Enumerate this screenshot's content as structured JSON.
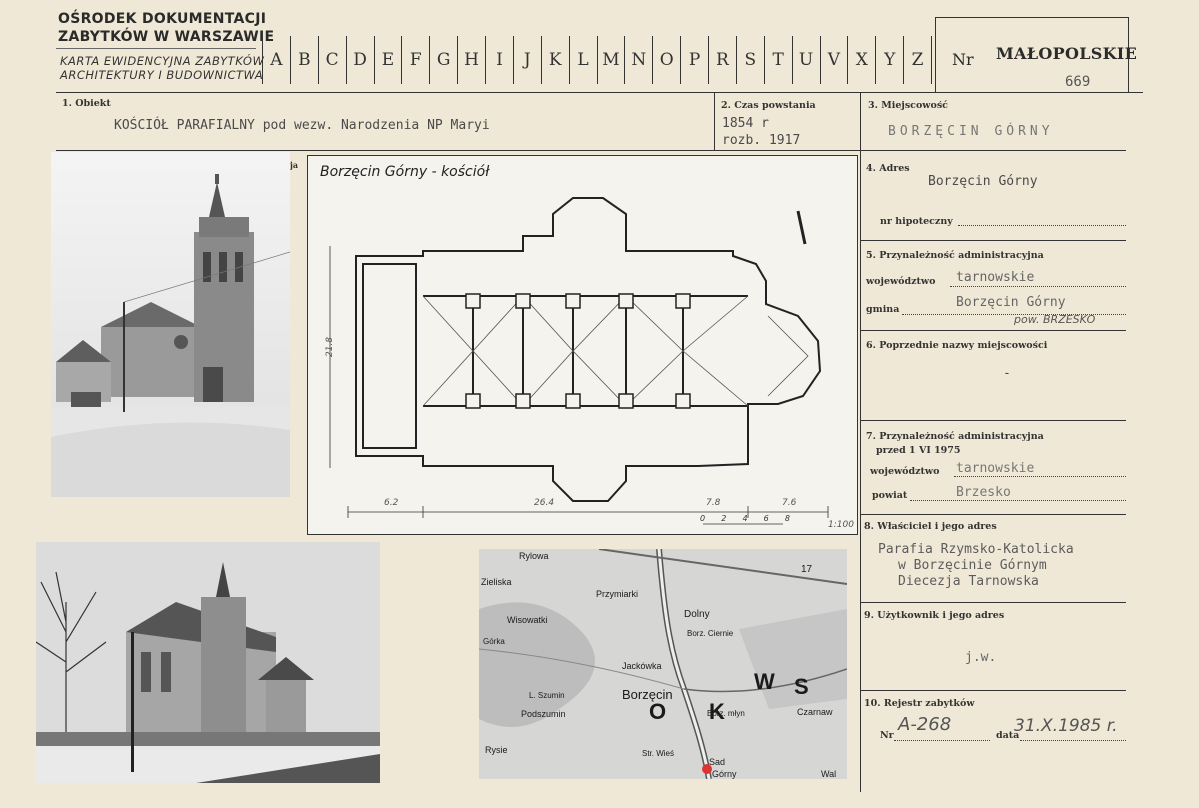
{
  "header": {
    "institution_line1": "OŚRODEK DOKUMENTACJI",
    "institution_line2": "ZABYTKÓW W WARSZAWIE",
    "card_line1": "KARTA EWIDENCYJNA ZABYTKÓW",
    "card_line2": "ARCHITEKTURY I BUDOWNICTWA",
    "letters": [
      "A",
      "B",
      "C",
      "D",
      "E",
      "F",
      "G",
      "H",
      "I",
      "J",
      "K",
      "L",
      "M",
      "N",
      "O",
      "P",
      "R",
      "S",
      "T",
      "U",
      "V",
      "X",
      "Y",
      "Z"
    ],
    "nr_label": "Nr",
    "region": "MAŁOPOLSKIE",
    "nr_value": "669"
  },
  "fields": {
    "obiekt_label": "1. Obiekt",
    "obiekt_value": "KOŚCIÓŁ PARAFIALNY pod wezw. Narodzenia NP Maryi",
    "czas_label": "2. Czas powstania",
    "czas_line1": "1854 r",
    "czas_line2": "rozb. 1917",
    "miejscowosc_label": "3. Miejscowość",
    "miejscowosc_value": "BORZĘCIN GÓRNY",
    "adres_label": "4. Adres",
    "adres_value": "Borzęcin Górny",
    "hipoteczny_label": "nr hipoteczny",
    "przynaleznosc_label": "5. Przynależność administracyjna",
    "wojewodztwo_label": "województwo",
    "wojewodztwo_value": "tarnowskie",
    "gmina_label": "gmina",
    "gmina_value": "Borzęcin Górny",
    "gmina_note": "pow. BRZESKO",
    "poprzednie_label": "6. Poprzednie nazwy miejscowości",
    "poprzednie_value": "-",
    "przynaleznosc_prev_label": "7. Przynależność administracyjna",
    "przed_label": "przed 1 VI 1975",
    "wojewodztwo_prev_label": "województwo",
    "wojewodztwo_prev_value": "tarnowskie",
    "powiat_label": "powiat",
    "powiat_value": "Brzesko",
    "wlasciciel_label": "8. Właściciel i jego adres",
    "wlasciciel_line1": "Parafia Rzymsko-Katolicka",
    "wlasciciel_line2": "w Borzęcinie Górnym",
    "wlasciciel_line3": "Diecezja Tarnowska",
    "uzytkownik_label": "9. Użytkownik i jego adres",
    "uzytkownik_value": "j.w.",
    "rejestr_label": "10. Rejestr zabytków",
    "rejestr_nr_label": "Nr",
    "rejestr_nr_value": "A-268",
    "rejestr_data_label": "data",
    "rejestr_data_value": "31.X.1985 r.",
    "fotografia_label": "ja"
  },
  "plan": {
    "title": "Borzęcin Górny - kościół",
    "dim_height": "21.8",
    "dim_1": "6.2",
    "dim_2": "26.4",
    "dim_3": "7.8",
    "dim_4": "7.6",
    "scale_ticks": [
      "0",
      "2",
      "4",
      "6",
      "8"
    ],
    "scale": "1:100"
  },
  "map": {
    "labels": [
      "Rylowa",
      "Zieliska",
      "Przymiarki",
      "Dolny",
      "Borz. Ciernie",
      "Wisowatki",
      "Górka",
      "Jackówka",
      "Borzęcin",
      "L. Szumin",
      "Podszumin",
      "Borz. młyn",
      "Rysie",
      "Str. Wieś",
      "Sad",
      "Czarnaw",
      "Górny",
      "Wal",
      "O",
      "K",
      "W",
      "S",
      "17"
    ]
  }
}
